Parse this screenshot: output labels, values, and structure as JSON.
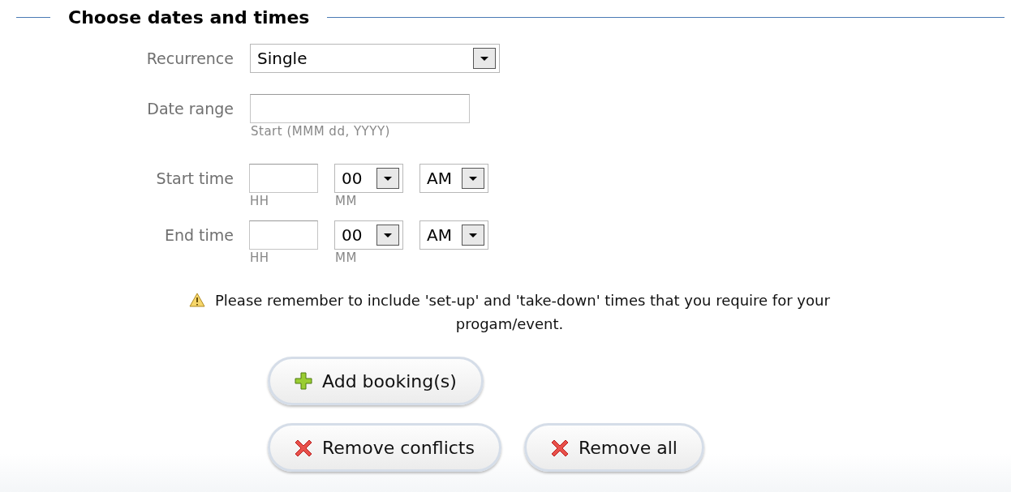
{
  "section": {
    "title": "Choose dates and times"
  },
  "recurrence": {
    "label": "Recurrence",
    "value": "Single"
  },
  "date_range": {
    "label": "Date range",
    "hint": "Start (MMM dd, YYYY)"
  },
  "times": [
    {
      "label": "Start time",
      "hour_hint": "HH",
      "minute": "00",
      "minute_hint": "MM",
      "period": "AM"
    },
    {
      "label": "End time",
      "hour_hint": "HH",
      "minute": "00",
      "minute_hint": "MM",
      "period": "AM"
    }
  ],
  "warning": "Please remember to include 'set-up' and 'take-down' times that you require for your progam/event.",
  "button_rows": [
    [
      {
        "label": "Add booking(s)",
        "kind": "add"
      }
    ],
    [
      {
        "label": "Remove conflicts",
        "kind": "remove"
      },
      {
        "label": "Remove all",
        "kind": "remove"
      }
    ]
  ]
}
